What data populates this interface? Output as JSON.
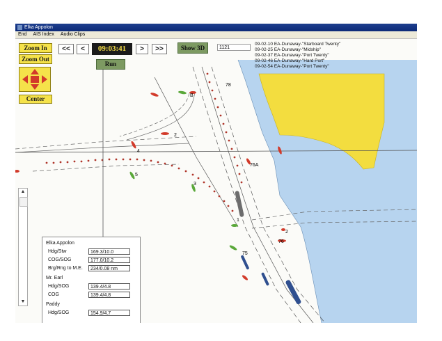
{
  "window": {
    "title": "Elka Appolon",
    "menu": [
      "End",
      "AIS Index",
      "Audio Clips"
    ]
  },
  "controls": {
    "zoom_in": "Zoom In",
    "zoom_out": "Zoom Out",
    "center": "Center",
    "rewind_fast": "<<",
    "rewind": "<",
    "forward": ">",
    "forward_fast": ">>",
    "clock": "09:03:41",
    "run": "Run",
    "show_3d": "Show 3D",
    "small_box": "1121"
  },
  "log": [
    "09-02-10 EA-Dunaway-\"Starboard Twenty\"",
    "09-02-25 EA-Dunaway-\"Midship\"",
    "09-02-37 EA-Dunaway-\"Port Twenty\"",
    "09-02-46 EA-Dunaway-\"Hard Port\"",
    "09-02-54 EA-Dunaway-\"Port Twenty\""
  ],
  "map_labels": {
    "b1": "B",
    "b2": "2",
    "b4": "4",
    "b5": "5",
    "b3": "3",
    "b1b": "1",
    "b76a": "76A",
    "b75": "75",
    "b76": "76",
    "b78": "78",
    "b2b": "2"
  },
  "info": {
    "vessel1": "Elka Appolon",
    "v1_hdg_label": "Hdg/Stw",
    "v1_hdg_value": "169.3/10.0",
    "v1_cog_label": "COG/SOG",
    "v1_cog_value": "177.0/10.2",
    "v1_brg_label": "Brg/Rng to M.E.",
    "v1_brg_value": "234/0.08 nm",
    "vessel2": "Mr. Earl",
    "v2_hdg_label": "Hdg/SOG",
    "v2_hdg_value": "139.4/4.8",
    "v2_cog_label": "COG",
    "v2_cog_value": "139.4/4.8",
    "vessel3": "Paddy",
    "v3_hdg_label": "Hdg/SOG",
    "v3_hdg_value": "154.9/4.7"
  },
  "colors": {
    "water": "#b7d4ef",
    "land": "#f3dd3f",
    "buoy_red": "#d23a2a",
    "buoy_green": "#5aa83a",
    "track": "#b0352a",
    "vessel": "#2f4f8f"
  }
}
